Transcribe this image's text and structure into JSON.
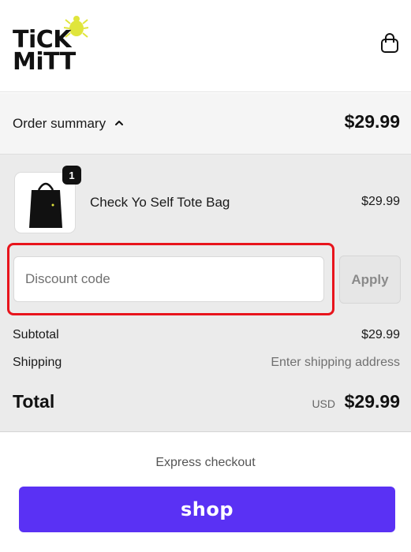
{
  "header": {
    "logo": {
      "line1": "TiCK",
      "line2": "MiTT"
    },
    "cart_icon": "shopping-bag-icon"
  },
  "summary": {
    "label": "Order summary",
    "chevron_icon": "chevron-up-icon",
    "total": "$29.99"
  },
  "line_item": {
    "quantity": "1",
    "name": "Check Yo Self Tote Bag",
    "price": "$29.99",
    "image_text": "check yo self"
  },
  "discount": {
    "placeholder": "Discount code",
    "apply_label": "Apply"
  },
  "totals": {
    "subtotal_label": "Subtotal",
    "subtotal_value": "$29.99",
    "shipping_label": "Shipping",
    "shipping_value": "Enter shipping address",
    "total_label": "Total",
    "currency": "USD",
    "total_value": "$29.99"
  },
  "express": {
    "label": "Express checkout",
    "shop_label": "shop"
  },
  "colors": {
    "accent": "#5a31f4",
    "highlight": "#e8141c",
    "logo_tick": "#e0e53c"
  }
}
